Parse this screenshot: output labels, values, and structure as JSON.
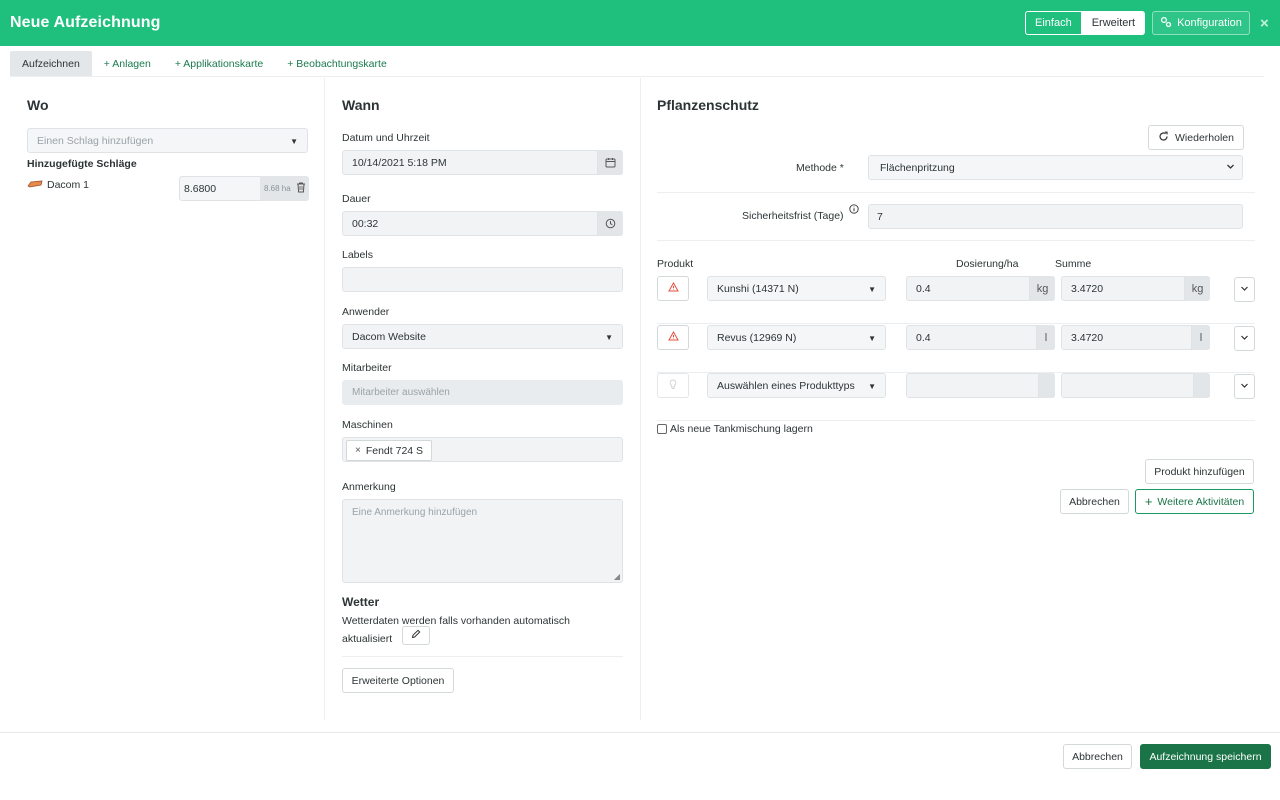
{
  "header": {
    "title": "Neue Aufzeichnung",
    "mode_simple": "Einfach",
    "mode_advanced": "Erweitert",
    "config_label": "Konfiguration",
    "close_symbol": "×"
  },
  "tabs": [
    {
      "label": "Aufzeichnen"
    },
    {
      "label": "+ Anlagen"
    },
    {
      "label": "+ Applikationskarte"
    },
    {
      "label": "+ Beobachtungskarte"
    }
  ],
  "wo": {
    "title": "Wo",
    "field_select_placeholder": "Einen Schlag hinzufügen",
    "added_label": "Hinzugefügte Schläge",
    "field_name": "Dacom 1",
    "field_value": "8.6800",
    "field_unit": "8.68 ha"
  },
  "wann": {
    "title": "Wann",
    "datetime_label": "Datum und Uhrzeit",
    "datetime_value": "10/14/2021 5:18 PM",
    "duration_label": "Dauer",
    "duration_value": "00:32",
    "labels_label": "Labels",
    "labels_value": "",
    "applicant_label": "Anwender",
    "applicant_value": "Dacom Website",
    "staff_label": "Mitarbeiter",
    "staff_placeholder": "Mitarbeiter auswählen",
    "machines_label": "Maschinen",
    "machine_chip": "Fendt 724 S",
    "chip_remove": "×",
    "note_label": "Anmerkung",
    "note_placeholder": "Eine Anmerkung hinzufügen",
    "weather_title": "Wetter",
    "weather_text": "Wetterdaten werden falls vorhanden automatisch aktualisiert",
    "advanced_options": "Erweiterte Optionen"
  },
  "pflanzenschutz": {
    "title": "Pflanzenschutz",
    "repeat_label": "Wiederholen",
    "method_label": "Methode *",
    "method_value": "Flächenpritzung",
    "safety_label": "Sicherheitsfrist (Tage)",
    "safety_value": "7",
    "col_product": "Produkt",
    "col_dose": "Dosierung/ha",
    "col_sum": "Summe",
    "products": [
      {
        "name": "Kunshi (14371 N)",
        "dose": "0.4",
        "dose_unit": "kg",
        "sum": "3.4720",
        "sum_unit": "kg",
        "warning": true
      },
      {
        "name": "Revus (12969 N)",
        "dose": "0.4",
        "dose_unit": "l",
        "sum": "3.4720",
        "sum_unit": "l",
        "warning": true
      },
      {
        "name": "Auswählen eines Produkttyps",
        "dose": "",
        "dose_unit": "",
        "sum": "",
        "sum_unit": "",
        "warning": false
      }
    ],
    "tank_mix_label": "Als neue Tankmischung lagern",
    "add_product": "Produkt hinzufügen",
    "cancel": "Abbrechen",
    "more_activities": "Weitere Aktivitäten"
  },
  "footer": {
    "cancel": "Abbrechen",
    "save": "Aufzeichnung speichern"
  },
  "colors": {
    "header_bg": "#1fc07e",
    "primary": "#1a7447",
    "warning": "#e74c3c"
  }
}
